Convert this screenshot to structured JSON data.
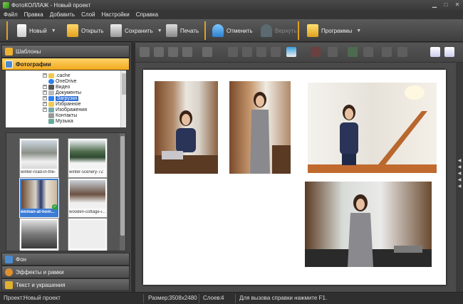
{
  "window": {
    "title": "ФотоКОЛЛАЖ - Новый проект"
  },
  "menu": [
    "Файл",
    "Правка",
    "Добавить",
    "Слой",
    "Настройки",
    "Справка"
  ],
  "toolbar": {
    "new_label": "Новый",
    "open_label": "Открыть",
    "save_label": "Сохранить",
    "print_label": "Печать",
    "undo_label": "Отменить",
    "redo_label": "Вернуть",
    "programs_label": "Программы"
  },
  "sidebar": {
    "templates_label": "Шаблоны",
    "photos_label": "Фотографии",
    "bg_label": "Фон",
    "effects_label": "Эффекты и рамки",
    "text_label": "Текст и украшения"
  },
  "tree": [
    {
      "label": ".cache",
      "icon": "folder-icon",
      "expander": "+"
    },
    {
      "label": "OneDrive",
      "icon": "cloud-icon",
      "expander": ""
    },
    {
      "label": "Видео",
      "icon": "video-folder-icon",
      "expander": "+"
    },
    {
      "label": "Документы",
      "icon": "documents-folder-icon",
      "expander": "+"
    },
    {
      "label": "Загрузки",
      "icon": "downloads-folder-icon",
      "expander": "+",
      "selected": true
    },
    {
      "label": "Избранное",
      "icon": "star-folder-icon",
      "expander": "+"
    },
    {
      "label": "Изображения",
      "icon": "images-folder-icon",
      "expander": "+"
    },
    {
      "label": "Контакты",
      "icon": "contacts-folder-icon",
      "expander": ""
    },
    {
      "label": "Музыка",
      "icon": "music-folder-icon",
      "expander": ""
    }
  ],
  "thumbnails": [
    {
      "caption": "winter-road-in-the-",
      "selected": false
    },
    {
      "caption": "winter-scenery-7Z",
      "selected": false
    },
    {
      "caption": "woman-at-hom...",
      "selected": true
    },
    {
      "caption": "wooden-cottage-i...",
      "selected": false
    },
    {
      "caption": "",
      "selected": false
    },
    {
      "caption": "",
      "selected": false
    }
  ],
  "status": {
    "project_label": "Проект:",
    "project_value": "Новый проект",
    "size_label": "Размер:",
    "size_value": "3508x2480",
    "layers_label": "Слоев:",
    "layers_value": "4",
    "help_text": "Для вызова справки нажмите F1."
  },
  "colors": {
    "accent": "#f2a81d",
    "selection": "#3070d8"
  }
}
